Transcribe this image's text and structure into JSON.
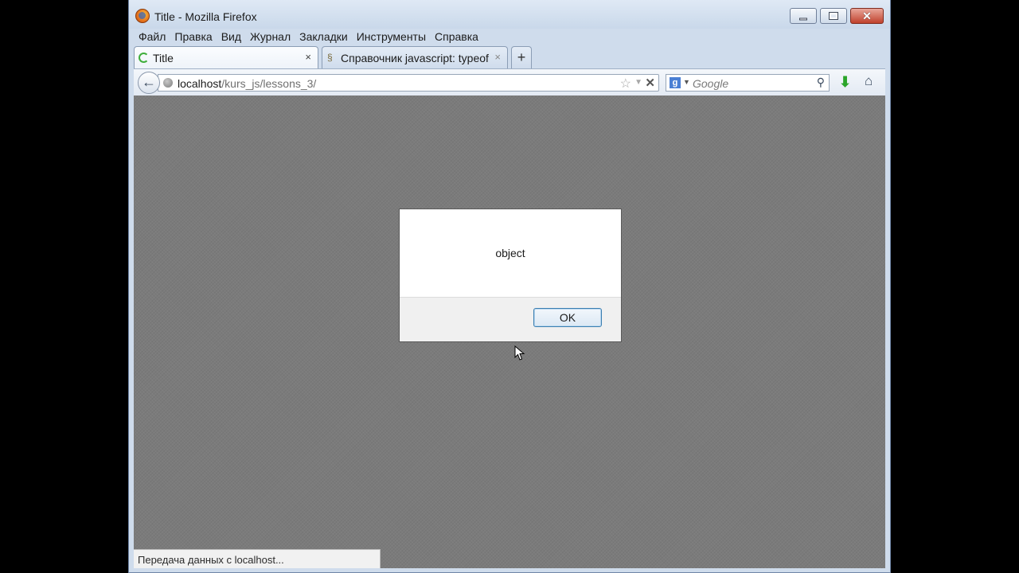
{
  "window": {
    "title": "Title - Mozilla Firefox"
  },
  "menu": {
    "items": [
      "Файл",
      "Правка",
      "Вид",
      "Журнал",
      "Закладки",
      "Инструменты",
      "Справка"
    ]
  },
  "tabs": [
    {
      "label": "Title",
      "close": "×"
    },
    {
      "label": "Справочник javascript: typeof",
      "close": "×"
    }
  ],
  "newtab_label": "+",
  "nav": {
    "back": "←",
    "url_host": "localhost",
    "url_path": "/kurs_js/lessons_3/",
    "star": "☆",
    "drop": "▼",
    "stop": "✕",
    "search_engine": "g",
    "search_drop": "▼",
    "search_placeholder": "Google",
    "magnify": "⚲",
    "download": "⬇",
    "home": "⌂"
  },
  "alert": {
    "message": "object",
    "ok_label": "OK"
  },
  "status": {
    "text": "Передача данных с localhost..."
  },
  "colors": {
    "content_bg": "#7b7b7b",
    "chrome_bg": "#cfdcec",
    "ok_border": "#3c7fb1"
  }
}
